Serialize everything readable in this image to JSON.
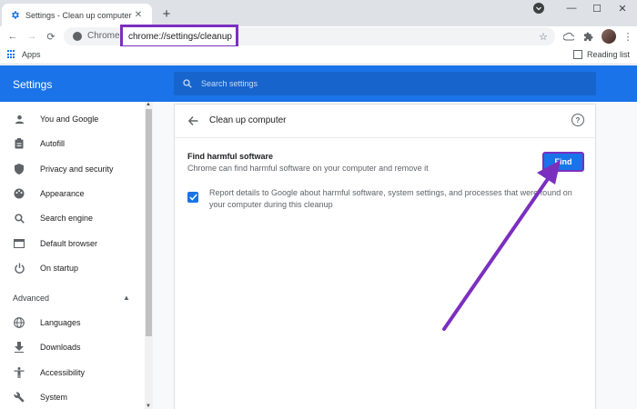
{
  "tab": {
    "title": "Settings - Clean up computer",
    "close": "✕",
    "new_tab": "+"
  },
  "window": {
    "minimize": "—",
    "maximize": "☐",
    "close": "✕"
  },
  "toolbar": {
    "site_label": "Chrome",
    "url": "chrome://settings/cleanup",
    "back": "←",
    "forward": "→",
    "reload": "⟳",
    "star": "☆",
    "menu": "⋮"
  },
  "bookmarks": {
    "apps": "Apps",
    "reading_list": "Reading list"
  },
  "header": {
    "title": "Settings",
    "search_placeholder": "Search settings"
  },
  "sidebar": {
    "items": [
      {
        "label": "You and Google",
        "icon": "person-icon"
      },
      {
        "label": "Autofill",
        "icon": "clipboard-icon"
      },
      {
        "label": "Privacy and security",
        "icon": "shield-icon"
      },
      {
        "label": "Appearance",
        "icon": "palette-icon"
      },
      {
        "label": "Search engine",
        "icon": "search-icon"
      },
      {
        "label": "Default browser",
        "icon": "browser-icon"
      },
      {
        "label": "On startup",
        "icon": "power-icon"
      }
    ],
    "advanced": "Advanced",
    "advanced_items": [
      {
        "label": "Languages",
        "icon": "globe-icon"
      },
      {
        "label": "Downloads",
        "icon": "download-icon"
      },
      {
        "label": "Accessibility",
        "icon": "accessibility-icon"
      },
      {
        "label": "System",
        "icon": "wrench-icon"
      }
    ]
  },
  "main": {
    "title": "Clean up computer",
    "find_title": "Find harmful software",
    "find_desc": "Chrome can find harmful software on your computer and remove it",
    "find_button": "Find",
    "report_text": "Report details to Google about harmful software, system settings, and processes that were found on your computer during this cleanup",
    "report_checked": true
  },
  "colors": {
    "accent": "#1a73e8",
    "annotation": "#7b2fbf"
  }
}
